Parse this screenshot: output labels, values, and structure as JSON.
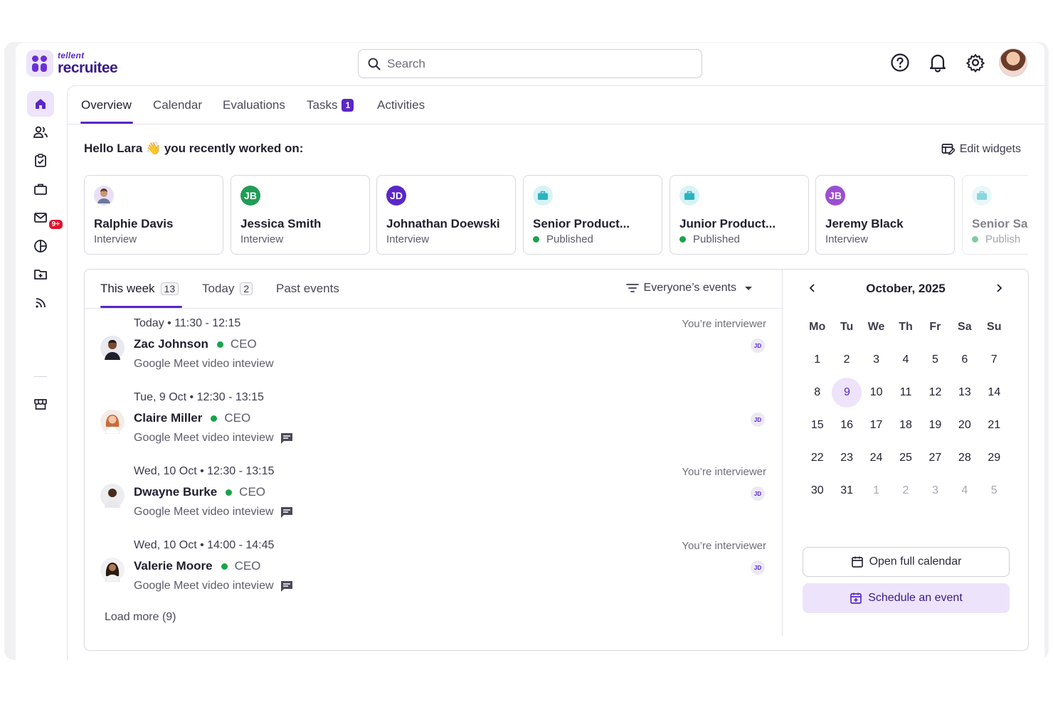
{
  "brand": {
    "small": "tellent",
    "big": "recruitee"
  },
  "search": {
    "placeholder": "Search"
  },
  "sidebar": {
    "mail_badge": "9+"
  },
  "tabs": [
    {
      "label": "Overview"
    },
    {
      "label": "Calendar"
    },
    {
      "label": "Evaluations"
    },
    {
      "label": "Tasks",
      "count": "1"
    },
    {
      "label": "Activities"
    }
  ],
  "greeting": {
    "name_part": "Hello Lara",
    "emoji": "👋",
    "rest": "you recently worked on:"
  },
  "edit_widgets": "Edit widgets",
  "recent": [
    {
      "initials": "",
      "name": "Ralphie Davis",
      "status": "Interview",
      "color": "#e8dff5",
      "kind": "person"
    },
    {
      "initials": "JB",
      "name": "Jessica Smith",
      "status": "Interview",
      "color": "#1f9d55",
      "kind": "person"
    },
    {
      "initials": "JD",
      "name": "Johnathan Doewski",
      "status": "Interview",
      "color": "#5a27c6",
      "kind": "person"
    },
    {
      "initials": "",
      "name": "Senior Product...",
      "status": "Published",
      "color": "#2bb3c0",
      "kind": "job"
    },
    {
      "initials": "",
      "name": "Junior Product...",
      "status": "Published",
      "color": "#2bb3c0",
      "kind": "job"
    },
    {
      "initials": "JB",
      "name": "Jeremy Black",
      "status": "Interview",
      "color": "#9b4fd0",
      "kind": "person"
    },
    {
      "initials": "",
      "name": "Senior Sa",
      "status": "Publish",
      "color": "#2bb3c0",
      "kind": "job"
    }
  ],
  "event_tabs": [
    {
      "label": "This week",
      "count": "13"
    },
    {
      "label": "Today",
      "count": "2"
    },
    {
      "label": "Past events",
      "count": ""
    }
  ],
  "filter": "Everyone’s events",
  "events": [
    {
      "time": "Today • 11:30 - 12:15",
      "name": "Zac Johnson",
      "role": "CEO",
      "meet": "Google Meet video inteview",
      "note": "You’re interviewer",
      "jd": "JD",
      "chat": false,
      "avatar": "#7a4a2e"
    },
    {
      "time": "Tue, 9 Oct • 12:30 - 13:15",
      "name": "Claire Miller",
      "role": "CEO",
      "meet": "Google Meet video inteview",
      "note": "",
      "jd": "JD",
      "chat": true,
      "avatar": "#c96a3a"
    },
    {
      "time": "Wed, 10 Oct • 12:30 - 13:15",
      "name": "Dwayne Burke",
      "role": "CEO",
      "meet": "Google Meet video inteview",
      "note": "You’re interviewer",
      "jd": "JD",
      "chat": true,
      "avatar": "#4a2a1a"
    },
    {
      "time": "Wed, 10 Oct • 14:00 - 14:45",
      "name": "Valerie Moore",
      "role": "CEO",
      "meet": "Google Meet video inteview",
      "note": "You’re interviewer",
      "jd": "JD",
      "chat": true,
      "avatar": "#2a1a12"
    }
  ],
  "load_more": "Load more (9)",
  "calendar": {
    "month": "October, 2025",
    "weekdays": [
      "Mo",
      "Tu",
      "We",
      "Th",
      "Fr",
      "Sa",
      "Su"
    ],
    "weeks": [
      [
        "1",
        "2",
        "3",
        "4",
        "5",
        "6",
        "7"
      ],
      [
        "8",
        "9",
        "10",
        "11",
        "12",
        "13",
        "14"
      ],
      [
        "15",
        "16",
        "17",
        "18",
        "19",
        "20",
        "21"
      ],
      [
        "22",
        "23",
        "24",
        "25",
        "27",
        "28",
        "29"
      ],
      [
        "30",
        "31",
        "1",
        "2",
        "3",
        "4",
        "5"
      ]
    ],
    "today": "9",
    "open_full": "Open full calendar",
    "schedule": "Schedule an event"
  }
}
